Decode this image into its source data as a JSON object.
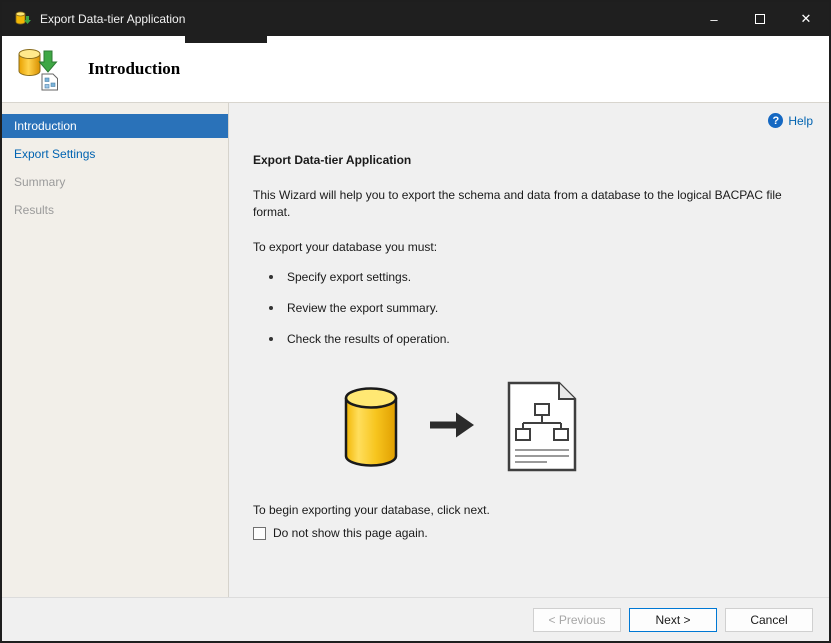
{
  "window": {
    "title": "Export Data-tier Application",
    "controls": {
      "minimize": "–",
      "close": "✕"
    }
  },
  "header": {
    "title": "Introduction"
  },
  "sidebar": {
    "items": [
      {
        "label": "Introduction",
        "state": "active"
      },
      {
        "label": "Export Settings",
        "state": "link"
      },
      {
        "label": "Summary",
        "state": "disabled"
      },
      {
        "label": "Results",
        "state": "disabled"
      }
    ]
  },
  "content": {
    "help_label": "Help",
    "heading": "Export Data-tier Application",
    "intro": "This Wizard will help you to export the schema and data from a database to the logical BACPAC file format.",
    "requirements_label": "To export your database you must:",
    "bullets": [
      "Specify export settings.",
      "Review the export summary.",
      "Check the results of operation."
    ],
    "begin_text": "To begin exporting your database, click next.",
    "checkbox_label": "Do not show this page again.",
    "checkbox_checked": false
  },
  "footer": {
    "previous_label": "< Previous",
    "next_label": "Next >",
    "cancel_label": "Cancel"
  },
  "colors": {
    "titlebar": "#1f1f1f",
    "active_step_blue": "#2a72b9",
    "link_blue": "#0063b1",
    "default_button_border": "#0078d4",
    "sidebar_bg": "#f2efe9",
    "content_bg": "#f0f0f0"
  }
}
